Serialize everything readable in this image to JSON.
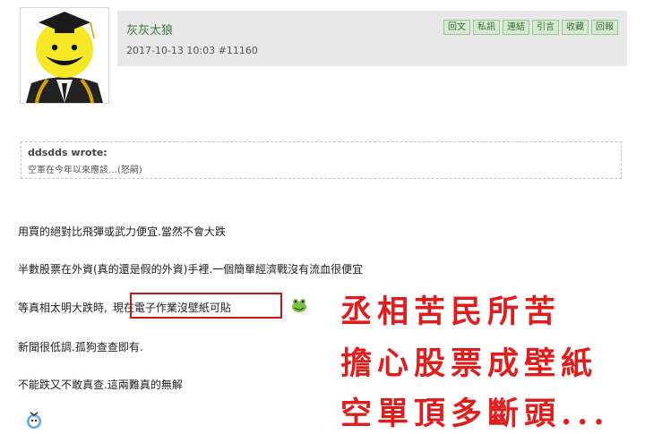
{
  "post": {
    "username": "灰灰太狼",
    "meta": "2017-10-13 10:03  #11160",
    "actions": [
      "回文",
      "私訊",
      "連結",
      "引言",
      "收藏",
      "回報"
    ]
  },
  "quote": {
    "author": "ddsdds wrote:",
    "text": "空軍在今年以來應該…(怒嗣)"
  },
  "body": {
    "line1": "用買的絕對比飛彈或武力便宜.當然不會大跌",
    "line2": "半數股票在外資(真的還是假的外資)手裡.一個簡單經濟戰沒有流血很便宜",
    "line3_prefix": "等真相太明大跌時,",
    "line3_highlight": "現在電子作業沒壁紙可貼",
    "line4": "新聞很低調.孤狗查查即有.",
    "line5": "不能跌又不敢真查.這兩難真的無解"
  },
  "overlay": {
    "line1": "丞相苦民所苦",
    "line2": "擔心股票成壁紙",
    "line3": "空單頂多斷頭..."
  },
  "colors": {
    "username": "#3a7a3a",
    "header_bg": "#e8e8e8",
    "highlight_border": "#d41414",
    "overlay_text": "#e21b1b"
  }
}
